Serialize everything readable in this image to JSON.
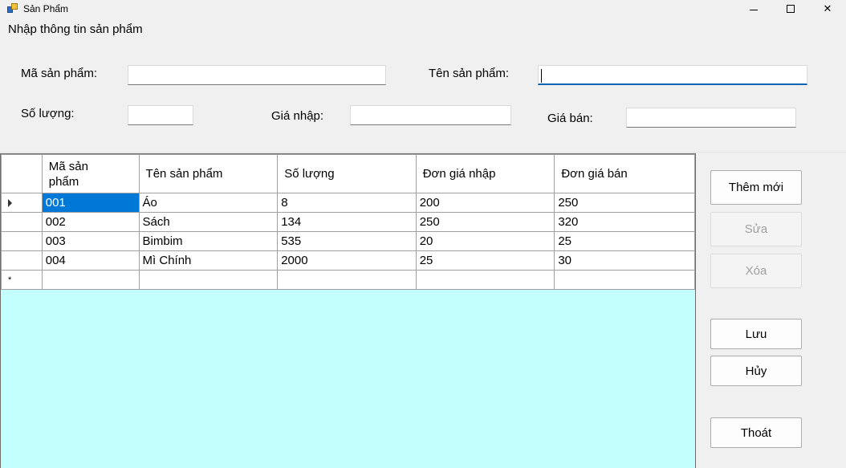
{
  "window": {
    "title": "Sản Phẩm"
  },
  "form": {
    "section_title": "Nhập thông tin sản phẩm",
    "fields": {
      "ma_sp_label": "Mã sản phẩm:",
      "ma_sp_value": "",
      "ten_sp_label": "Tên sản phẩm:",
      "ten_sp_value": "",
      "so_luong_label": "Số lượng:",
      "so_luong_value": "",
      "gia_nhap_label": "Giá nhập:",
      "gia_nhap_value": "",
      "gia_ban_label": "Giá bán:",
      "gia_ban_value": ""
    }
  },
  "grid": {
    "columns": [
      "Mã sản phẩm",
      "Tên sản phẩm",
      "Số lượng",
      "Đơn giá nhập",
      "Đơn giá bán"
    ],
    "rows": [
      [
        "001",
        "Áo",
        "8",
        "200",
        "250"
      ],
      [
        "002",
        "Sách",
        "134",
        "250",
        "320"
      ],
      [
        "003",
        "Bimbim",
        "535",
        "20",
        "25"
      ],
      [
        "004",
        "Mì Chính",
        "2000",
        "25",
        "30"
      ]
    ],
    "new_row_marker": "*",
    "background_color": "#c2fffd",
    "selection_color": "#0078d7"
  },
  "buttons": {
    "them_moi": "Thêm mới",
    "sua": "Sửa",
    "xoa": "Xóa",
    "luu": "Lưu",
    "huy": "Hủy",
    "thoat": "Thoát"
  }
}
